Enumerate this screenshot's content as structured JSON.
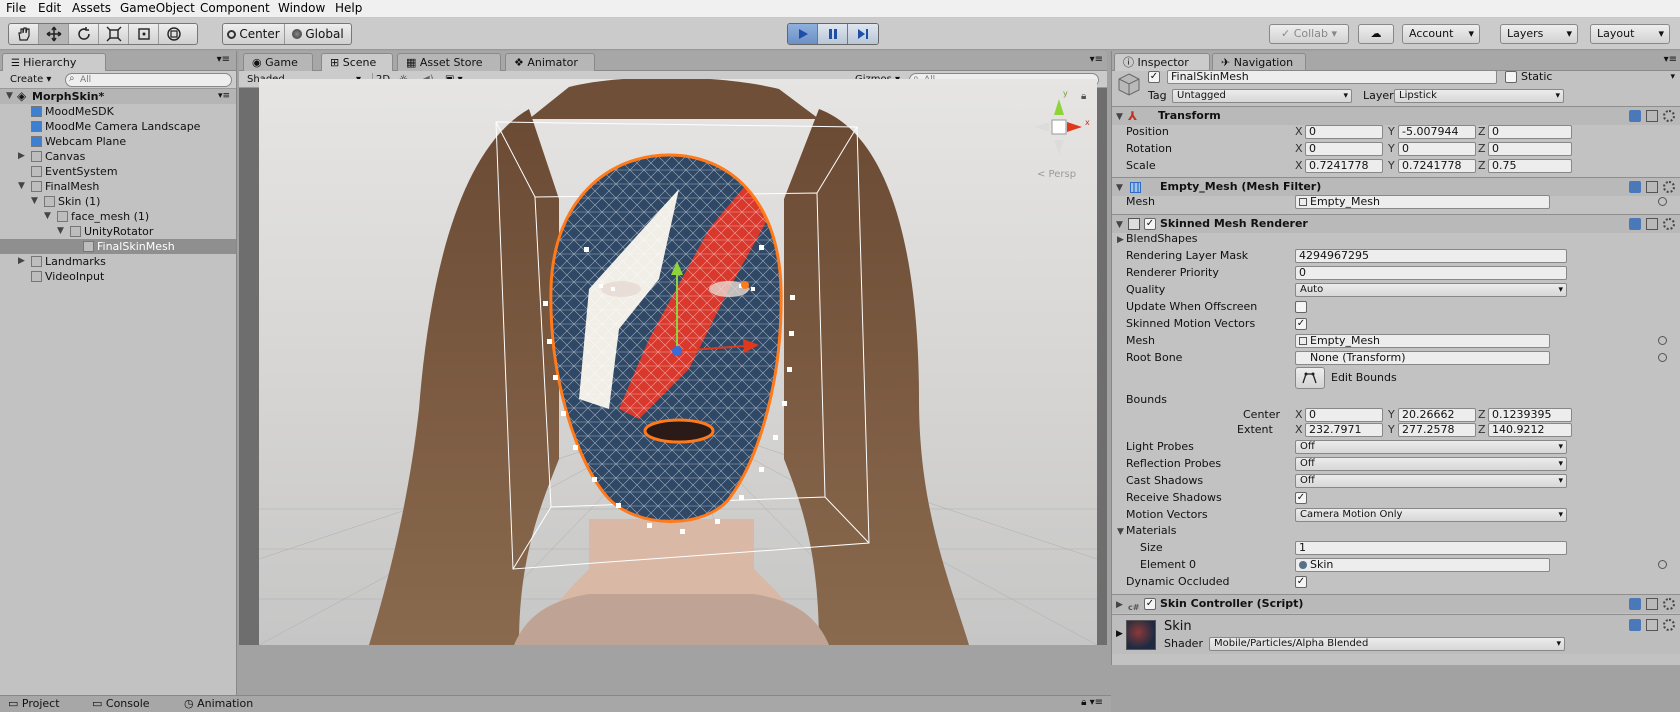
{
  "menu": [
    "File",
    "Edit",
    "Assets",
    "GameObject",
    "Component",
    "Window",
    "Help"
  ],
  "toolbar": {
    "pivot": "Center",
    "space": "Global",
    "collab": "Collab",
    "account": "Account",
    "layers": "Layers",
    "layout": "Layout"
  },
  "hierarchy": {
    "tab": "Hierarchy",
    "create": "Create",
    "search_placeholder": "All",
    "scene_name": "MorphSkin*",
    "items": [
      {
        "label": "MoodMeSDK",
        "depth": 1,
        "expand": ""
      },
      {
        "label": "MoodMe Camera Landscape",
        "depth": 1,
        "expand": ""
      },
      {
        "label": "Webcam Plane",
        "depth": 1,
        "expand": ""
      },
      {
        "label": "Canvas",
        "depth": 1,
        "expand": "closed"
      },
      {
        "label": "EventSystem",
        "depth": 1,
        "expand": ""
      },
      {
        "label": "FinalMesh",
        "depth": 1,
        "expand": "open"
      },
      {
        "label": "Skin (1)",
        "depth": 2,
        "expand": "open"
      },
      {
        "label": "face_mesh (1)",
        "depth": 3,
        "expand": "open"
      },
      {
        "label": "UnityRotator",
        "depth": 4,
        "expand": "open"
      },
      {
        "label": "FinalSkinMesh",
        "depth": 5,
        "expand": "",
        "selected": true
      },
      {
        "label": "Landmarks",
        "depth": 1,
        "expand": "closed"
      },
      {
        "label": "VideoInput",
        "depth": 1,
        "expand": ""
      }
    ]
  },
  "scene": {
    "tabs": [
      "Game",
      "Scene",
      "Asset Store",
      "Animator"
    ],
    "shading": "Shaded",
    "mode2d": "2D",
    "gizmos": "Gizmos",
    "search_placeholder": "All",
    "persp": "< Persp"
  },
  "inspector": {
    "tabs": [
      "Inspector",
      "Navigation"
    ],
    "object_name": "FinalSkinMesh",
    "static_label": "Static",
    "tag_label": "Tag",
    "tag_value": "Untagged",
    "layer_label": "Layer",
    "layer_value": "Lipstick",
    "transform": {
      "title": "Transform",
      "position": {
        "label": "Position",
        "x": "0",
        "y": "-5.007944",
        "z": "0"
      },
      "rotation": {
        "label": "Rotation",
        "x": "0",
        "y": "0",
        "z": "0"
      },
      "scale": {
        "label": "Scale",
        "x": "0.7241778",
        "y": "0.7241778",
        "z": "0.75"
      }
    },
    "mesh_filter": {
      "title": "Empty_Mesh (Mesh Filter)",
      "mesh_label": "Mesh",
      "mesh_value": "Empty_Mesh"
    },
    "skinned": {
      "title": "Skinned Mesh Renderer",
      "blendshapes": "BlendShapes",
      "rows": [
        {
          "label": "Rendering Layer Mask",
          "value": "4294967295",
          "kind": "field"
        },
        {
          "label": "Renderer Priority",
          "value": "0",
          "kind": "field"
        },
        {
          "label": "Quality",
          "value": "Auto",
          "kind": "dropdown"
        },
        {
          "label": "Update When Offscreen",
          "value": "",
          "kind": "check-off"
        },
        {
          "label": "Skinned Motion Vectors",
          "value": "",
          "kind": "check-on"
        },
        {
          "label": "Mesh",
          "value": "Empty_Mesh",
          "kind": "object"
        },
        {
          "label": "Root Bone",
          "value": "None (Transform)",
          "kind": "object"
        }
      ],
      "edit_bounds": "Edit Bounds",
      "bounds_label": "Bounds",
      "center": {
        "label": "Center",
        "x": "0",
        "y": "20.26662",
        "z": "0.1239395"
      },
      "extent": {
        "label": "Extent",
        "x": "232.7971",
        "y": "277.2578",
        "z": "140.9212"
      },
      "rows2": [
        {
          "label": "Light Probes",
          "value": "Off",
          "kind": "dropdown"
        },
        {
          "label": "Reflection Probes",
          "value": "Off",
          "kind": "dropdown"
        },
        {
          "label": "Cast Shadows",
          "value": "Off",
          "kind": "dropdown"
        },
        {
          "label": "Receive Shadows",
          "value": "",
          "kind": "check-on"
        },
        {
          "label": "Motion Vectors",
          "value": "Camera Motion Only",
          "kind": "dropdown"
        }
      ],
      "materials_label": "Materials",
      "size_label": "Size",
      "size_value": "1",
      "element_label": "Element 0",
      "element_value": "Skin",
      "dynamic_label": "Dynamic Occluded"
    },
    "skin_controller": "Skin Controller (Script)",
    "material": {
      "name": "Skin",
      "shader_label": "Shader",
      "shader_value": "Mobile/Particles/Alpha Blended"
    }
  },
  "bottom_tabs": [
    "Project",
    "Console",
    "Animation"
  ],
  "colors": {
    "accent": "#3a72c4",
    "gizmo_x": "#e0381c",
    "gizmo_y": "#8fd23a",
    "mesh_outline": "#ff7a1a"
  }
}
